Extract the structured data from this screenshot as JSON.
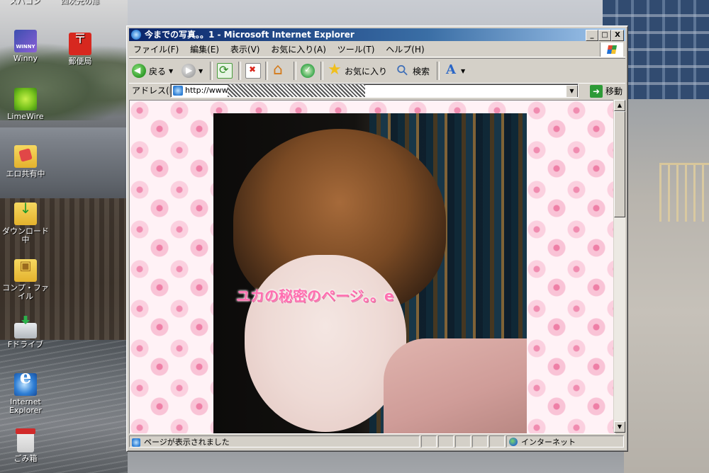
{
  "desktop": {
    "top_fragments": [
      "スパコン",
      "四次元の扉"
    ],
    "icons": [
      {
        "label": "Winny",
        "icon": "winny-icon"
      },
      {
        "label": "郵便局",
        "icon": "post-office-icon"
      },
      {
        "label": "LimeWire",
        "icon": "limewire-icon"
      },
      {
        "label": "エロ共有中",
        "icon": "folder-icon"
      },
      {
        "label": "ダウンロード中",
        "icon": "download-folder-icon"
      },
      {
        "label": "コンプ・ファイル",
        "icon": "compressed-folder-icon"
      },
      {
        "label": "Fドライブ",
        "icon": "drive-icon"
      },
      {
        "label": "Internet Explorer",
        "icon": "ie-icon"
      },
      {
        "label": "ごみ箱",
        "icon": "recycle-bin-icon"
      }
    ]
  },
  "window": {
    "title": "今までの写真。。1 - Microsoft Internet Explorer",
    "title_buttons": [
      "_",
      "□",
      "X"
    ],
    "menu": [
      "ファイル(F)",
      "編集(E)",
      "表示(V)",
      "お気に入り(A)",
      "ツール(T)",
      "ヘルプ(H)"
    ],
    "toolbar": {
      "back_label": "戻る",
      "favorites_label": "お気に入り",
      "search_label": "検索"
    },
    "address": {
      "label": "アドレス(D)",
      "url_prefix": "http://www.",
      "go_label": "移動"
    },
    "page": {
      "overlay_title": "ユカの秘密のページ。。e"
    },
    "status": {
      "message": "ページが表示されました",
      "zone": "インターネット"
    }
  }
}
